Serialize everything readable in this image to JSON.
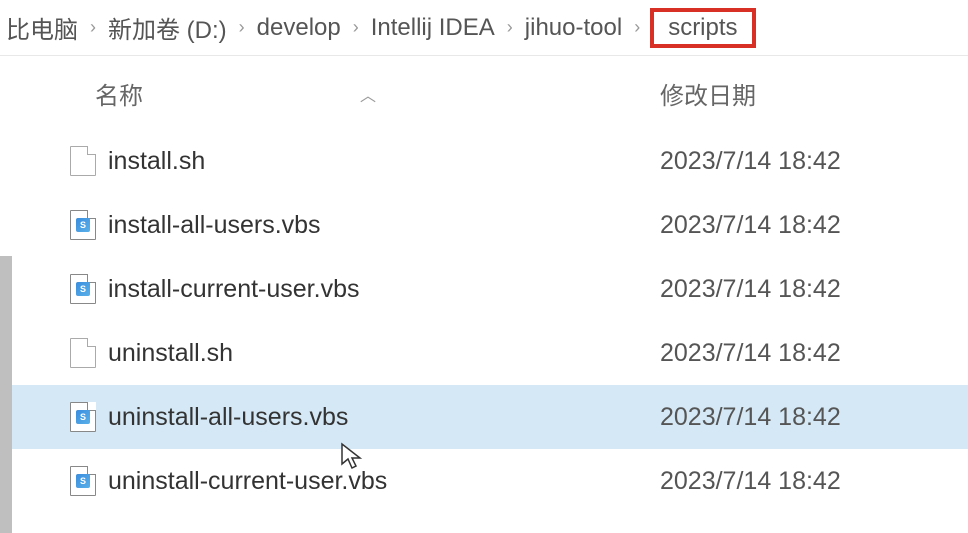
{
  "breadcrumb": {
    "items": [
      "比电脑",
      "新加卷 (D:)",
      "develop",
      "Intellij IDEA",
      "jihuo-tool",
      "scripts"
    ],
    "highlightIndex": 5
  },
  "columns": {
    "name": "名称",
    "date": "修改日期"
  },
  "files": [
    {
      "name": "install.sh",
      "date": "2023/7/14 18:42",
      "type": "blank",
      "selected": false
    },
    {
      "name": "install-all-users.vbs",
      "date": "2023/7/14 18:42",
      "type": "vbs",
      "selected": false
    },
    {
      "name": "install-current-user.vbs",
      "date": "2023/7/14 18:42",
      "type": "vbs",
      "selected": false
    },
    {
      "name": "uninstall.sh",
      "date": "2023/7/14 18:42",
      "type": "blank",
      "selected": false
    },
    {
      "name": "uninstall-all-users.vbs",
      "date": "2023/7/14 18:42",
      "type": "vbs",
      "selected": true
    },
    {
      "name": "uninstall-current-user.vbs",
      "date": "2023/7/14 18:42",
      "type": "vbs",
      "selected": false
    }
  ]
}
